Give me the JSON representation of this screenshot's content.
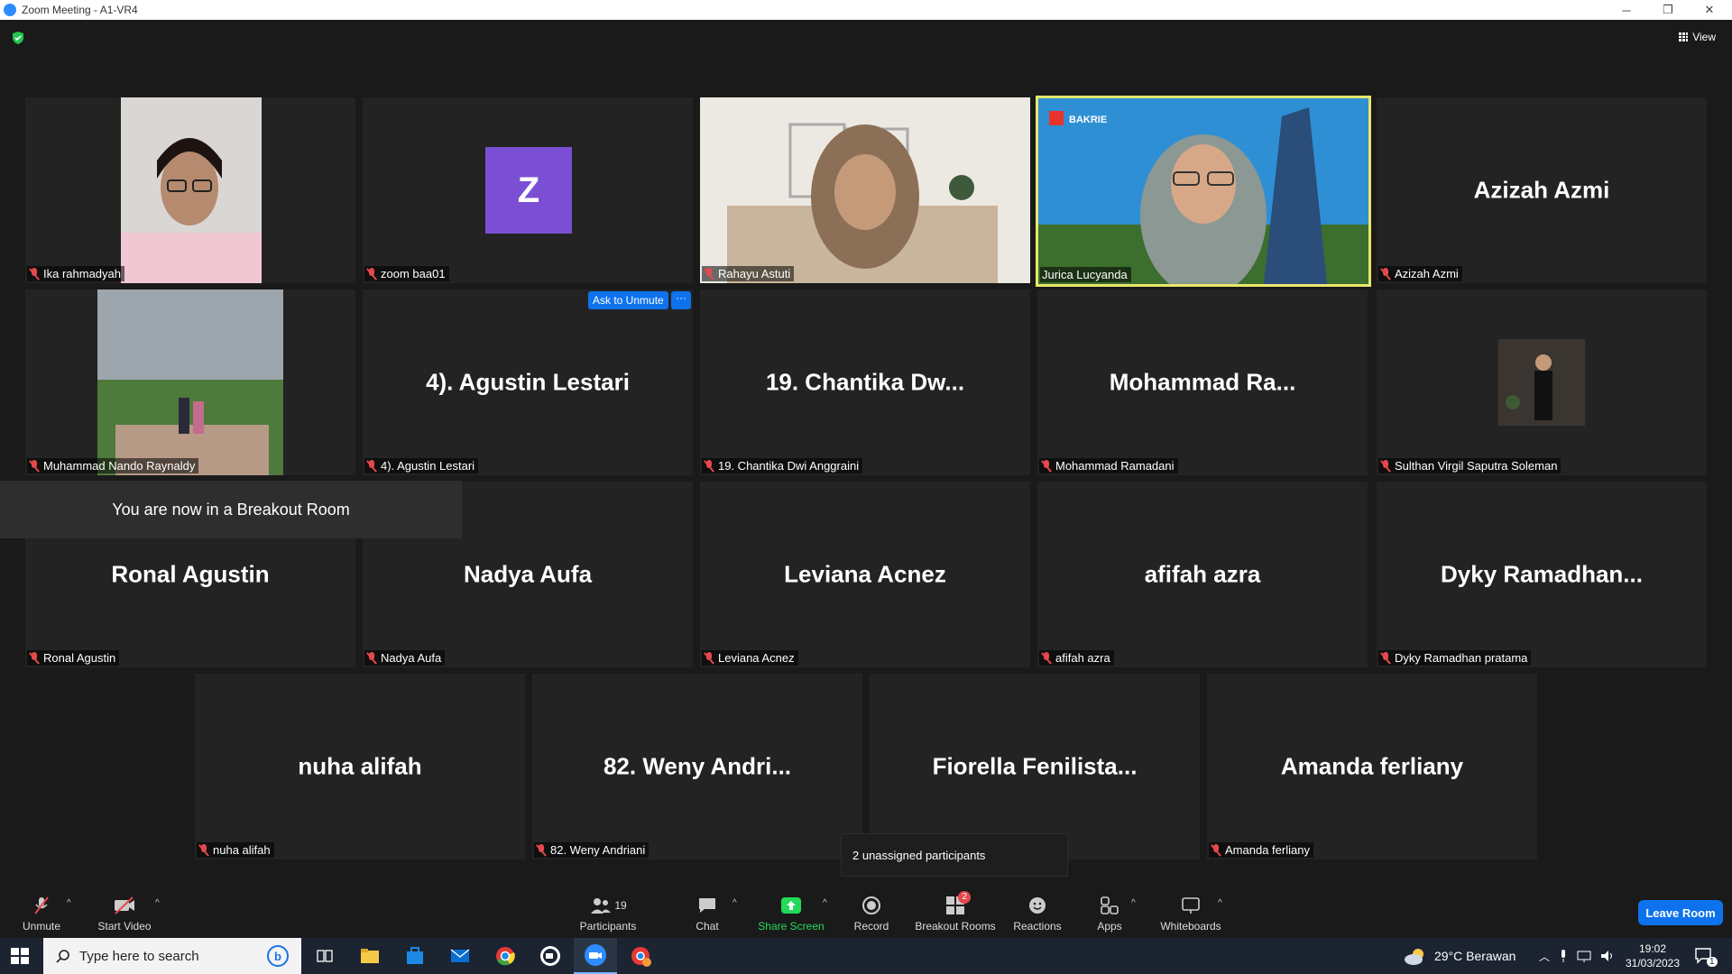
{
  "window": {
    "title": "Zoom Meeting - A1-VR4",
    "minimize": "─",
    "restore": "❐",
    "close": "✕"
  },
  "view_button": {
    "label": "View"
  },
  "tiles": [
    {
      "id": "ika",
      "name": "Ika rahmadyah",
      "type": "video"
    },
    {
      "id": "zoom",
      "name": "zoom baa01",
      "type": "avatar",
      "avatar_letter": "Z",
      "avatar_color": "#7b4fd4"
    },
    {
      "id": "rahayu",
      "name": "Rahayu Astuti",
      "type": "video"
    },
    {
      "id": "jurica",
      "name": "Jurica Lucyanda",
      "type": "video",
      "active_speaker": true,
      "bg_logo": "BAKRIE"
    },
    {
      "id": "azizah",
      "name": "Azizah Azmi",
      "big": "Azizah Azmi",
      "type": "name"
    },
    {
      "id": "nando",
      "name": "Muhammad Nando Raynaldy",
      "type": "video"
    },
    {
      "id": "agustin",
      "name": "4). Agustin Lestari",
      "big": "4). Agustin Lestari",
      "type": "name",
      "ask_unmute": "Ask to Unmute",
      "more": "···"
    },
    {
      "id": "chantika",
      "name": "19. Chantika Dwi Anggraini",
      "big": "19. Chantika Dw...",
      "type": "name"
    },
    {
      "id": "ramadani",
      "name": "Mohammad Ramadani",
      "big": "Mohammad Ra...",
      "type": "name"
    },
    {
      "id": "sulthan",
      "name": "Sulthan Virgil Saputra Soleman",
      "type": "photo"
    },
    {
      "id": "ronal",
      "name": "Ronal Agustin",
      "big": "Ronal Agustin",
      "type": "name"
    },
    {
      "id": "nadya",
      "name": "Nadya Aufa",
      "big": "Nadya Aufa",
      "type": "name"
    },
    {
      "id": "leviana",
      "name": "Leviana Acnez",
      "big": "Leviana Acnez",
      "type": "name"
    },
    {
      "id": "afifah",
      "name": "afifah azra",
      "big": "afifah azra",
      "type": "name"
    },
    {
      "id": "dyky",
      "name": "Dyky Ramadhan pratama",
      "big": "Dyky Ramadhan...",
      "type": "name"
    },
    {
      "id": "nuha",
      "name": "nuha alifah",
      "big": "nuha alifah",
      "type": "name"
    },
    {
      "id": "weny",
      "name": "82. Weny Andriani",
      "big": "82. Weny Andri...",
      "type": "name"
    },
    {
      "id": "fiorella",
      "name": "",
      "big": "Fiorella Fenilista...",
      "type": "name"
    },
    {
      "id": "amanda",
      "name": "Amanda ferliany",
      "big": "Amanda ferliany",
      "type": "name"
    }
  ],
  "breakout_toast": "You are now in a Breakout Room",
  "unassigned_popup": "2 unassigned participants",
  "toolbar": {
    "unmute": "Unmute",
    "start_video": "Start Video",
    "participants": "Participants",
    "participants_count": "19",
    "chat": "Chat",
    "share_screen": "Share Screen",
    "record": "Record",
    "breakout_rooms": "Breakout Rooms",
    "breakout_badge": "2",
    "reactions": "Reactions",
    "apps": "Apps",
    "whiteboards": "Whiteboards",
    "leave_room": "Leave Room",
    "caret": "^"
  },
  "taskbar": {
    "search_placeholder": "Type here to search",
    "weather": "29°C Berawan",
    "time": "19:02",
    "date": "31/03/2023",
    "notifications": "1"
  },
  "colors": {
    "accent": "#0e72ed",
    "active_speaker": "#e9e66b",
    "muted": "#e5484d",
    "share_green": "#23d959"
  }
}
